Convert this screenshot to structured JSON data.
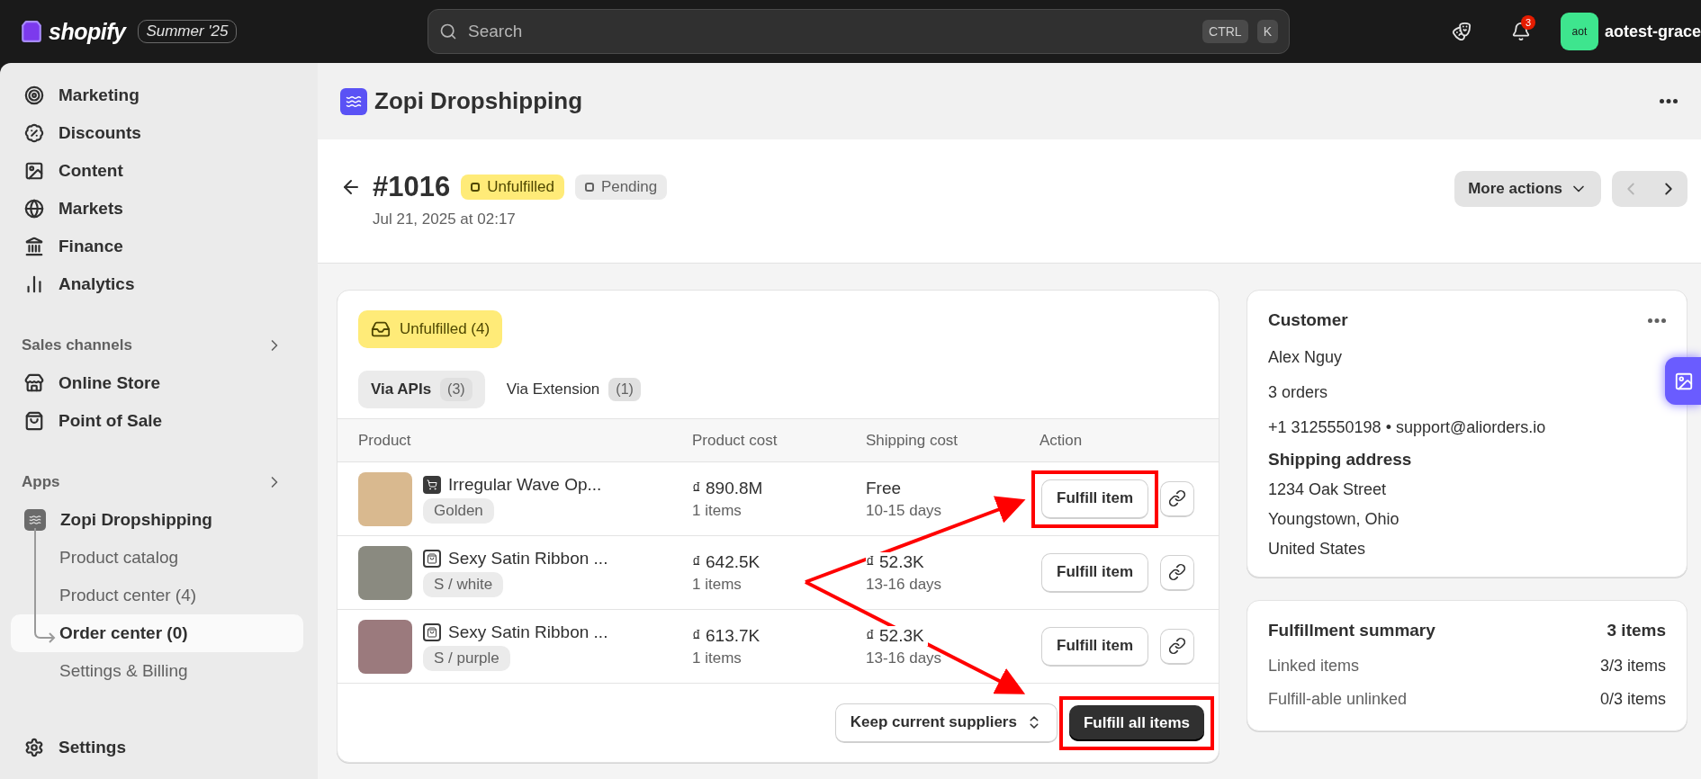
{
  "top_bar": {
    "logo_text": "shopify",
    "edition": "Summer '25",
    "search": {
      "placeholder": "Search",
      "keys": [
        "CTRL",
        "K"
      ]
    },
    "notification_count": "3",
    "avatar_initials": "aot",
    "store_name": "aotest-grace"
  },
  "sidebar": {
    "items": [
      {
        "kind": "item",
        "label": "Marketing"
      },
      {
        "kind": "item",
        "label": "Discounts"
      },
      {
        "kind": "item",
        "label": "Content"
      },
      {
        "kind": "item",
        "label": "Markets"
      },
      {
        "kind": "item",
        "label": "Finance"
      },
      {
        "kind": "item",
        "label": "Analytics"
      },
      {
        "kind": "heading",
        "label": "Sales channels"
      },
      {
        "kind": "item",
        "label": "Online Store"
      },
      {
        "kind": "item",
        "label": "Point of Sale"
      },
      {
        "kind": "heading",
        "label": "Apps"
      },
      {
        "kind": "app",
        "label": "Zopi Dropshipping",
        "children": [
          {
            "label": "Product catalog",
            "selected": false
          },
          {
            "label": "Product center (4)",
            "selected": false
          },
          {
            "label": "Order center (0)",
            "selected": true
          },
          {
            "label": "Settings & Billing",
            "selected": false
          }
        ]
      }
    ],
    "footer_item": "Settings"
  },
  "app_header": {
    "title": "Zopi Dropshipping"
  },
  "order": {
    "number": "#1016",
    "badges": [
      {
        "kind": "attention",
        "label": "Unfulfilled"
      },
      {
        "kind": "neutral",
        "label": "Pending"
      }
    ],
    "date": "Jul 21, 2025 at 02:17",
    "more_actions": "More actions",
    "prev_disabled": true,
    "next_disabled": false
  },
  "fulfillment_card": {
    "status": "Unfulfilled (4)",
    "tabs": [
      {
        "label": "Via APIs",
        "count": "(3)",
        "selected": true
      },
      {
        "label": "Via Extension",
        "count": "(1)",
        "selected": false
      }
    ],
    "columns": [
      "Product",
      "Product cost",
      "Shipping cost",
      "Action"
    ],
    "rows": [
      {
        "kind": "marketplace",
        "name": "Irregular Wave Op...",
        "variant": "Golden",
        "cost": "₫ 890.8M",
        "quantity": "1 items",
        "shipping": "Free",
        "days": "10-15 days",
        "action": "Fulfill item",
        "highlighted": true
      },
      {
        "kind": "store",
        "name": "Sexy Satin Ribbon ...",
        "variant": "S / white",
        "cost": "₫ 642.5K",
        "quantity": "1 items",
        "shipping": "₫ 52.3K",
        "days": "13-16 days",
        "action": "Fulfill item",
        "highlighted": false
      },
      {
        "kind": "store",
        "name": "Sexy Satin Ribbon ...",
        "variant": "S / purple",
        "cost": "₫ 613.7K",
        "quantity": "1 items",
        "shipping": "₫ 52.3K",
        "days": "13-16 days",
        "action": "Fulfill item",
        "highlighted": false
      }
    ],
    "supplier_select": "Keep current suppliers",
    "fulfill_all": {
      "label": "Fulfill all items",
      "highlighted": true
    }
  },
  "customer_card": {
    "title": "Customer",
    "name": "Alex Nguy",
    "orders": "3 orders",
    "contact": "+1 3125550198 • support@aliorders.io",
    "shipping_title": "Shipping address",
    "address": [
      "1234 Oak Street",
      "Youngstown, Ohio",
      "United States"
    ]
  },
  "summary_card": {
    "title": "Fulfillment summary",
    "total": "3 items",
    "rows": [
      {
        "label": "Linked items",
        "value": "3/3 items"
      },
      {
        "label": "Fulfill-able unlinked",
        "value": "0/3 items"
      }
    ]
  }
}
